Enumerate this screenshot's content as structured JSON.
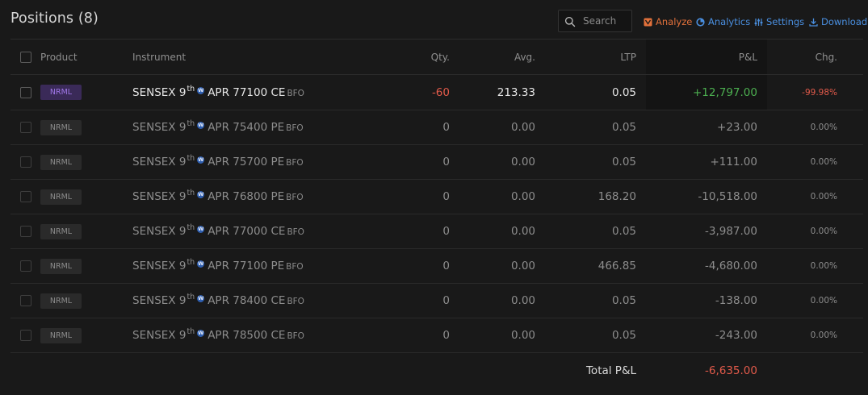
{
  "page": {
    "title": "Positions (8)"
  },
  "search": {
    "placeholder": "Search",
    "value": ""
  },
  "toolbar": {
    "analyze": "Analyze",
    "analytics": "Analytics",
    "settings": "Settings",
    "download": "Download"
  },
  "colors": {
    "accent_blue": "#4a8fe0",
    "analyze_orange": "#e2713b",
    "profit_green": "#4caf50",
    "loss_red": "#e25a4a",
    "product_badge_purple": "#a077e8"
  },
  "columns": {
    "product": "Product",
    "instrument": "Instrument",
    "qty": "Qty.",
    "avg": "Avg.",
    "ltp": "LTP",
    "pnl": "P&L",
    "chg": "Chg."
  },
  "rows": [
    {
      "product": "NRML",
      "symbol": "SENSEX 9",
      "sup": "th",
      "weekly": "W",
      "detail": "APR 77100 CE",
      "exchange": "BFO",
      "qty": "-60",
      "avg": "213.33",
      "ltp": "0.05",
      "pnl": "+12,797.00",
      "chg": "-99.98%"
    },
    {
      "product": "NRML",
      "symbol": "SENSEX 9",
      "sup": "th",
      "weekly": "W",
      "detail": "APR 75400 PE",
      "exchange": "BFO",
      "qty": "0",
      "avg": "0.00",
      "ltp": "0.05",
      "pnl": "+23.00",
      "chg": "0.00%"
    },
    {
      "product": "NRML",
      "symbol": "SENSEX 9",
      "sup": "th",
      "weekly": "W",
      "detail": "APR 75700 PE",
      "exchange": "BFO",
      "qty": "0",
      "avg": "0.00",
      "ltp": "0.05",
      "pnl": "+111.00",
      "chg": "0.00%"
    },
    {
      "product": "NRML",
      "symbol": "SENSEX 9",
      "sup": "th",
      "weekly": "W",
      "detail": "APR 76800 PE",
      "exchange": "BFO",
      "qty": "0",
      "avg": "0.00",
      "ltp": "168.20",
      "pnl": "-10,518.00",
      "chg": "0.00%"
    },
    {
      "product": "NRML",
      "symbol": "SENSEX 9",
      "sup": "th",
      "weekly": "W",
      "detail": "APR 77000 CE",
      "exchange": "BFO",
      "qty": "0",
      "avg": "0.00",
      "ltp": "0.05",
      "pnl": "-3,987.00",
      "chg": "0.00%"
    },
    {
      "product": "NRML",
      "symbol": "SENSEX 9",
      "sup": "th",
      "weekly": "W",
      "detail": "APR 77100 PE",
      "exchange": "BFO",
      "qty": "0",
      "avg": "0.00",
      "ltp": "466.85",
      "pnl": "-4,680.00",
      "chg": "0.00%"
    },
    {
      "product": "NRML",
      "symbol": "SENSEX 9",
      "sup": "th",
      "weekly": "W",
      "detail": "APR 78400 CE",
      "exchange": "BFO",
      "qty": "0",
      "avg": "0.00",
      "ltp": "0.05",
      "pnl": "-138.00",
      "chg": "0.00%"
    },
    {
      "product": "NRML",
      "symbol": "SENSEX 9",
      "sup": "th",
      "weekly": "W",
      "detail": "APR 78500 CE",
      "exchange": "BFO",
      "qty": "0",
      "avg": "0.00",
      "ltp": "0.05",
      "pnl": "-243.00",
      "chg": "0.00%"
    }
  ],
  "footer": {
    "total_label": "Total P&L",
    "total_value": "-6,635.00"
  }
}
